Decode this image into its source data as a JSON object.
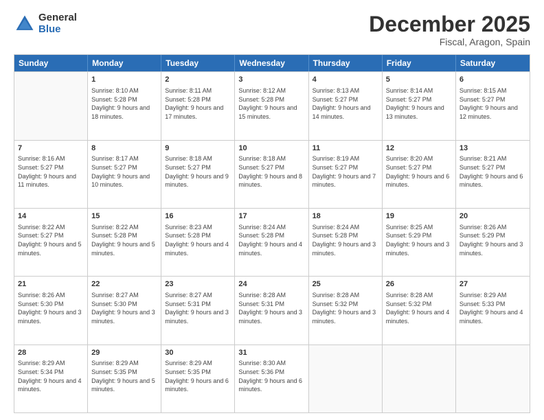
{
  "logo": {
    "general": "General",
    "blue": "Blue"
  },
  "title": {
    "month": "December 2025",
    "location": "Fiscal, Aragon, Spain"
  },
  "header_days": [
    "Sunday",
    "Monday",
    "Tuesday",
    "Wednesday",
    "Thursday",
    "Friday",
    "Saturday"
  ],
  "weeks": [
    [
      {
        "day": "",
        "sunrise": "",
        "sunset": "",
        "daylight": "",
        "empty": true
      },
      {
        "day": "1",
        "sunrise": "Sunrise: 8:10 AM",
        "sunset": "Sunset: 5:28 PM",
        "daylight": "Daylight: 9 hours and 18 minutes."
      },
      {
        "day": "2",
        "sunrise": "Sunrise: 8:11 AM",
        "sunset": "Sunset: 5:28 PM",
        "daylight": "Daylight: 9 hours and 17 minutes."
      },
      {
        "day": "3",
        "sunrise": "Sunrise: 8:12 AM",
        "sunset": "Sunset: 5:28 PM",
        "daylight": "Daylight: 9 hours and 15 minutes."
      },
      {
        "day": "4",
        "sunrise": "Sunrise: 8:13 AM",
        "sunset": "Sunset: 5:27 PM",
        "daylight": "Daylight: 9 hours and 14 minutes."
      },
      {
        "day": "5",
        "sunrise": "Sunrise: 8:14 AM",
        "sunset": "Sunset: 5:27 PM",
        "daylight": "Daylight: 9 hours and 13 minutes."
      },
      {
        "day": "6",
        "sunrise": "Sunrise: 8:15 AM",
        "sunset": "Sunset: 5:27 PM",
        "daylight": "Daylight: 9 hours and 12 minutes."
      }
    ],
    [
      {
        "day": "7",
        "sunrise": "Sunrise: 8:16 AM",
        "sunset": "Sunset: 5:27 PM",
        "daylight": "Daylight: 9 hours and 11 minutes."
      },
      {
        "day": "8",
        "sunrise": "Sunrise: 8:17 AM",
        "sunset": "Sunset: 5:27 PM",
        "daylight": "Daylight: 9 hours and 10 minutes."
      },
      {
        "day": "9",
        "sunrise": "Sunrise: 8:18 AM",
        "sunset": "Sunset: 5:27 PM",
        "daylight": "Daylight: 9 hours and 9 minutes."
      },
      {
        "day": "10",
        "sunrise": "Sunrise: 8:18 AM",
        "sunset": "Sunset: 5:27 PM",
        "daylight": "Daylight: 9 hours and 8 minutes."
      },
      {
        "day": "11",
        "sunrise": "Sunrise: 8:19 AM",
        "sunset": "Sunset: 5:27 PM",
        "daylight": "Daylight: 9 hours and 7 minutes."
      },
      {
        "day": "12",
        "sunrise": "Sunrise: 8:20 AM",
        "sunset": "Sunset: 5:27 PM",
        "daylight": "Daylight: 9 hours and 6 minutes."
      },
      {
        "day": "13",
        "sunrise": "Sunrise: 8:21 AM",
        "sunset": "Sunset: 5:27 PM",
        "daylight": "Daylight: 9 hours and 6 minutes."
      }
    ],
    [
      {
        "day": "14",
        "sunrise": "Sunrise: 8:22 AM",
        "sunset": "Sunset: 5:27 PM",
        "daylight": "Daylight: 9 hours and 5 minutes."
      },
      {
        "day": "15",
        "sunrise": "Sunrise: 8:22 AM",
        "sunset": "Sunset: 5:28 PM",
        "daylight": "Daylight: 9 hours and 5 minutes."
      },
      {
        "day": "16",
        "sunrise": "Sunrise: 8:23 AM",
        "sunset": "Sunset: 5:28 PM",
        "daylight": "Daylight: 9 hours and 4 minutes."
      },
      {
        "day": "17",
        "sunrise": "Sunrise: 8:24 AM",
        "sunset": "Sunset: 5:28 PM",
        "daylight": "Daylight: 9 hours and 4 minutes."
      },
      {
        "day": "18",
        "sunrise": "Sunrise: 8:24 AM",
        "sunset": "Sunset: 5:28 PM",
        "daylight": "Daylight: 9 hours and 3 minutes."
      },
      {
        "day": "19",
        "sunrise": "Sunrise: 8:25 AM",
        "sunset": "Sunset: 5:29 PM",
        "daylight": "Daylight: 9 hours and 3 minutes."
      },
      {
        "day": "20",
        "sunrise": "Sunrise: 8:26 AM",
        "sunset": "Sunset: 5:29 PM",
        "daylight": "Daylight: 9 hours and 3 minutes."
      }
    ],
    [
      {
        "day": "21",
        "sunrise": "Sunrise: 8:26 AM",
        "sunset": "Sunset: 5:30 PM",
        "daylight": "Daylight: 9 hours and 3 minutes."
      },
      {
        "day": "22",
        "sunrise": "Sunrise: 8:27 AM",
        "sunset": "Sunset: 5:30 PM",
        "daylight": "Daylight: 9 hours and 3 minutes."
      },
      {
        "day": "23",
        "sunrise": "Sunrise: 8:27 AM",
        "sunset": "Sunset: 5:31 PM",
        "daylight": "Daylight: 9 hours and 3 minutes."
      },
      {
        "day": "24",
        "sunrise": "Sunrise: 8:28 AM",
        "sunset": "Sunset: 5:31 PM",
        "daylight": "Daylight: 9 hours and 3 minutes."
      },
      {
        "day": "25",
        "sunrise": "Sunrise: 8:28 AM",
        "sunset": "Sunset: 5:32 PM",
        "daylight": "Daylight: 9 hours and 3 minutes."
      },
      {
        "day": "26",
        "sunrise": "Sunrise: 8:28 AM",
        "sunset": "Sunset: 5:32 PM",
        "daylight": "Daylight: 9 hours and 4 minutes."
      },
      {
        "day": "27",
        "sunrise": "Sunrise: 8:29 AM",
        "sunset": "Sunset: 5:33 PM",
        "daylight": "Daylight: 9 hours and 4 minutes."
      }
    ],
    [
      {
        "day": "28",
        "sunrise": "Sunrise: 8:29 AM",
        "sunset": "Sunset: 5:34 PM",
        "daylight": "Daylight: 9 hours and 4 minutes."
      },
      {
        "day": "29",
        "sunrise": "Sunrise: 8:29 AM",
        "sunset": "Sunset: 5:35 PM",
        "daylight": "Daylight: 9 hours and 5 minutes."
      },
      {
        "day": "30",
        "sunrise": "Sunrise: 8:29 AM",
        "sunset": "Sunset: 5:35 PM",
        "daylight": "Daylight: 9 hours and 6 minutes."
      },
      {
        "day": "31",
        "sunrise": "Sunrise: 8:30 AM",
        "sunset": "Sunset: 5:36 PM",
        "daylight": "Daylight: 9 hours and 6 minutes."
      },
      {
        "day": "",
        "sunrise": "",
        "sunset": "",
        "daylight": "",
        "empty": true
      },
      {
        "day": "",
        "sunrise": "",
        "sunset": "",
        "daylight": "",
        "empty": true
      },
      {
        "day": "",
        "sunrise": "",
        "sunset": "",
        "daylight": "",
        "empty": true
      }
    ]
  ]
}
